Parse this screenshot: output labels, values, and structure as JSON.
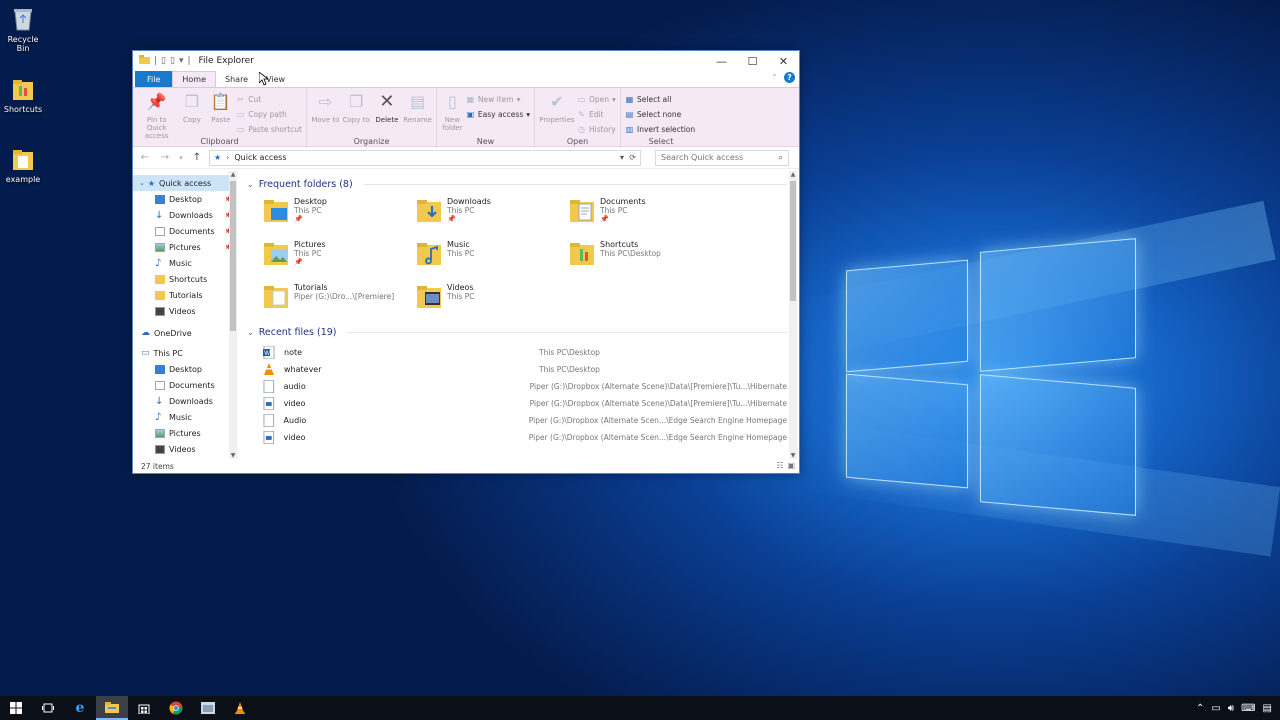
{
  "desktop": {
    "icons": [
      {
        "label": "Recycle Bin"
      },
      {
        "label": "Shortcuts"
      },
      {
        "label": "example"
      }
    ]
  },
  "window": {
    "title": "File Explorer",
    "qat_glyphs": [
      "▯",
      "▯",
      "▾",
      "|"
    ],
    "controls": {
      "minimize": "—",
      "maximize": "☐",
      "close": "✕"
    },
    "tabs": {
      "file": "File",
      "home": "Home",
      "share": "Share",
      "view": "View"
    },
    "ribbon": {
      "clipboard": {
        "label": "Clipboard",
        "pin": "Pin to Quick access",
        "copy": "Copy",
        "paste": "Paste",
        "cut": "Cut",
        "copy_path": "Copy path",
        "paste_shortcut": "Paste shortcut"
      },
      "organize": {
        "label": "Organize",
        "move_to": "Move to",
        "copy_to": "Copy to",
        "delete": "Delete",
        "rename": "Rename"
      },
      "new": {
        "label": "New",
        "new_folder": "New folder",
        "new_item": "New item",
        "easy_access": "Easy access"
      },
      "open": {
        "label": "Open",
        "properties": "Properties",
        "open": "Open",
        "edit": "Edit",
        "history": "History"
      },
      "select": {
        "label": "Select",
        "select_all": "Select all",
        "select_none": "Select none",
        "invert": "Invert selection"
      }
    },
    "address": {
      "path": "Quick access",
      "separator": "›"
    },
    "search": {
      "placeholder": "Search Quick access"
    },
    "nav": {
      "quick_access": "Quick access",
      "quick_items": [
        "Desktop",
        "Downloads",
        "Documents",
        "Pictures",
        "Music",
        "Shortcuts",
        "Tutorials",
        "Videos"
      ],
      "onedrive": "OneDrive",
      "this_pc": "This PC",
      "pc_items": [
        "Desktop",
        "Documents",
        "Downloads",
        "Music",
        "Pictures",
        "Videos"
      ]
    },
    "frequent": {
      "heading": "Frequent folders (8)",
      "folders": [
        {
          "name": "Desktop",
          "loc": "This PC",
          "pinned": "📌"
        },
        {
          "name": "Downloads",
          "loc": "This PC",
          "pinned": "📌"
        },
        {
          "name": "Documents",
          "loc": "This PC",
          "pinned": "📌"
        },
        {
          "name": "Pictures",
          "loc": "This PC",
          "pinned": "📌"
        },
        {
          "name": "Music",
          "loc": "This PC",
          "pinned": ""
        },
        {
          "name": "Shortcuts",
          "loc": "This PC\\Desktop",
          "pinned": ""
        },
        {
          "name": "Tutorials",
          "loc": "Piper (G:)\\Dro...\\[Premiere]",
          "pinned": ""
        },
        {
          "name": "Videos",
          "loc": "This PC",
          "pinned": ""
        }
      ]
    },
    "recent": {
      "heading": "Recent files (19)",
      "files": [
        {
          "name": "note",
          "path": "This PC\\Desktop"
        },
        {
          "name": "whatever",
          "path": "This PC\\Desktop"
        },
        {
          "name": "audio",
          "path": "Piper (G:)\\Dropbox (Alternate Scene)\\Data\\[Premiere]\\Tu...\\Hibernate"
        },
        {
          "name": "video",
          "path": "Piper (G:)\\Dropbox (Alternate Scene)\\Data\\[Premiere]\\Tu...\\Hibernate"
        },
        {
          "name": "Audio",
          "path": "Piper (G:)\\Dropbox (Alternate Scen...\\Edge Search Engine Homepage"
        },
        {
          "name": "video",
          "path": "Piper (G:)\\Dropbox (Alternate Scen...\\Edge Search Engine Homepage"
        }
      ]
    },
    "status": {
      "count": "27 items"
    }
  },
  "colors": {
    "ribbon_bg": "#f6e9f6",
    "file_tab": "#1979ca",
    "folder_yellow": "#f2c94c",
    "section_text": "#1e3287"
  }
}
